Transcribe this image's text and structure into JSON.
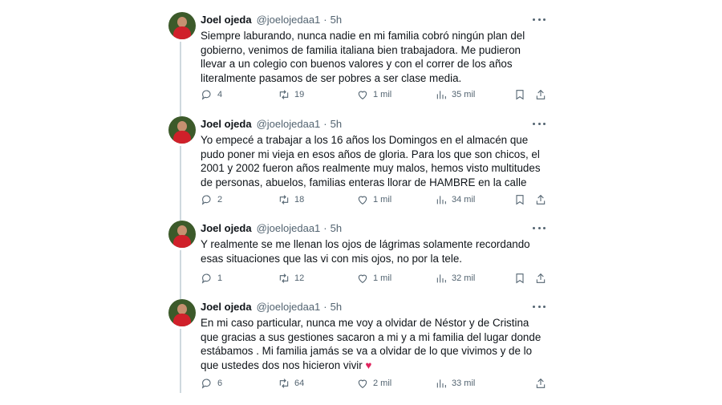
{
  "tweets": [
    {
      "name": "Joel ojeda",
      "handle": "@joelojedaa1",
      "separator": "·",
      "time": "5h",
      "text": "Siempre laburando, nunca nadie en mi familia cobró ningún plan del gobierno, venimos de familia italiana bien trabajadora. Me pudieron llevar a un colegio con buenos valores y con el correr de los años literalmente pasamos de ser pobres a ser clase media.",
      "replies": "4",
      "retweets": "19",
      "likes": "1 mil",
      "views": "35 mil"
    },
    {
      "name": "Joel ojeda",
      "handle": "@joelojedaa1",
      "separator": "·",
      "time": "5h",
      "text": "Yo empecé a trabajar a los 16 años los Domingos en el almacén que pudo poner mi vieja en esos años de gloria. Para los que son chicos, el 2001 y 2002 fueron años realmente muy malos, hemos visto multitudes de personas, abuelos, familias enteras llorar de HAMBRE en la calle",
      "replies": "2",
      "retweets": "18",
      "likes": "1 mil",
      "views": "34 mil"
    },
    {
      "name": "Joel ojeda",
      "handle": "@joelojedaa1",
      "separator": "·",
      "time": "5h",
      "text": "Y realmente se me llenan los ojos de lágrimas solamente recordando esas situaciones que las vi con mis ojos, no por la tele.",
      "replies": "1",
      "retweets": "12",
      "likes": "1 mil",
      "views": "32 mil"
    },
    {
      "name": "Joel ojeda",
      "handle": "@joelojedaa1",
      "separator": "·",
      "time": "5h",
      "text": "En mi caso particular, nunca me voy a olvidar de Néstor y de Cristina que gracias a sus gestiones sacaron a mi y a mi familia del lugar donde estábamos . Mi familia jamás se va a olvidar de lo que vivimos y de lo que ustedes dos nos hicieron vivir",
      "emoji": "♥",
      "replies": "6",
      "retweets": "64",
      "likes": "2 mil",
      "views": "33 mil"
    }
  ],
  "icons": [
    "reply-icon",
    "retweet-icon",
    "like-icon",
    "views-icon",
    "bookmark-icon",
    "share-icon",
    "more-icon"
  ],
  "colors": {
    "text": "#0f1419",
    "muted": "#536471",
    "thread_line": "#cfd9de",
    "heart": "#e0245e"
  }
}
